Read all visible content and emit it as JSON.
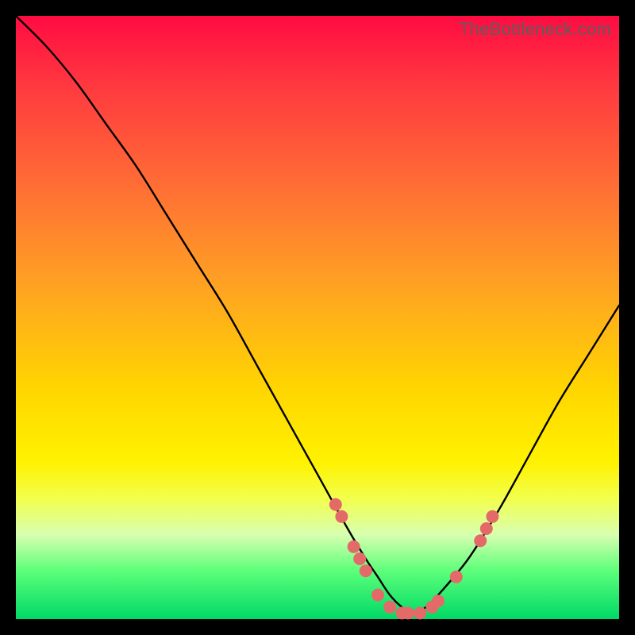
{
  "watermark": "TheBottleneck.com",
  "chart_data": {
    "type": "line",
    "title": "",
    "xlabel": "",
    "ylabel": "",
    "xlim": [
      0,
      100
    ],
    "ylim": [
      0,
      100
    ],
    "series": [
      {
        "name": "bottleneck-curve",
        "x": [
          0,
          5,
          10,
          15,
          20,
          25,
          30,
          35,
          40,
          45,
          50,
          55,
          58,
          60,
          62,
          64,
          66,
          68,
          70,
          75,
          80,
          85,
          90,
          95,
          100
        ],
        "y": [
          100,
          95,
          89,
          82,
          75,
          67,
          59,
          51,
          42,
          33,
          24,
          15,
          10,
          7,
          4,
          2,
          1,
          2,
          4,
          10,
          18,
          27,
          36,
          44,
          52
        ]
      }
    ],
    "markers": {
      "name": "highlight-dots",
      "points": [
        {
          "x": 53,
          "y": 19
        },
        {
          "x": 54,
          "y": 17
        },
        {
          "x": 56,
          "y": 12
        },
        {
          "x": 57,
          "y": 10
        },
        {
          "x": 58,
          "y": 8
        },
        {
          "x": 60,
          "y": 4
        },
        {
          "x": 62,
          "y": 2
        },
        {
          "x": 64,
          "y": 1
        },
        {
          "x": 65,
          "y": 1
        },
        {
          "x": 67,
          "y": 1
        },
        {
          "x": 69,
          "y": 2
        },
        {
          "x": 70,
          "y": 3
        },
        {
          "x": 73,
          "y": 7
        },
        {
          "x": 77,
          "y": 13
        },
        {
          "x": 78,
          "y": 15
        },
        {
          "x": 79,
          "y": 17
        }
      ]
    },
    "gradient_stops": [
      {
        "pos": 0.0,
        "color": "#ff0b42"
      },
      {
        "pos": 0.12,
        "color": "#ff3a3f"
      },
      {
        "pos": 0.28,
        "color": "#ff6d35"
      },
      {
        "pos": 0.45,
        "color": "#ffa322"
      },
      {
        "pos": 0.62,
        "color": "#ffd600"
      },
      {
        "pos": 0.74,
        "color": "#fff200"
      },
      {
        "pos": 0.8,
        "color": "#f2ff4d"
      },
      {
        "pos": 0.86,
        "color": "#d8ffb0"
      },
      {
        "pos": 0.92,
        "color": "#5cff7a"
      },
      {
        "pos": 1.0,
        "color": "#00d966"
      }
    ]
  }
}
